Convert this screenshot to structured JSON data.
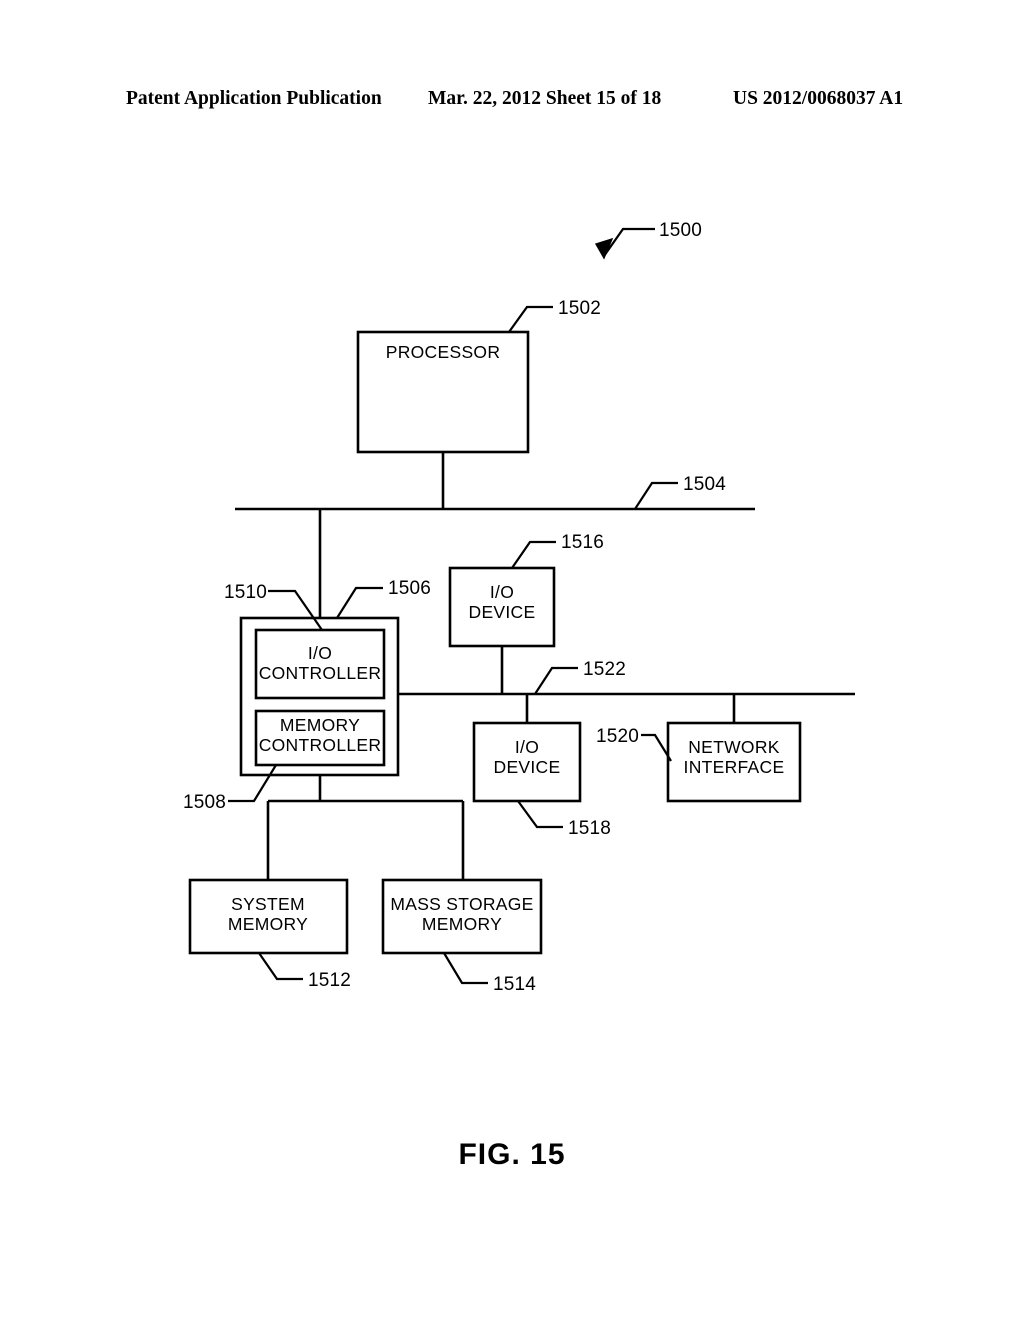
{
  "header": {
    "publication": "Patent Application Publication",
    "date_sheet": "Mar. 22, 2012  Sheet 15 of 18",
    "patent_number": "US 2012/0068037 A1"
  },
  "figure": {
    "caption": "FIG. 15",
    "system_ref": "1500"
  },
  "blocks": {
    "processor": {
      "line1": "PROCESSOR",
      "ref": "1502"
    },
    "chipset": {
      "ref": "1506"
    },
    "io_controller": {
      "line1": "I/O",
      "line2": "CONTROLLER",
      "ref": "1510"
    },
    "memory_controller": {
      "line1": "MEMORY",
      "line2": "CONTROLLER",
      "ref": "1508"
    },
    "io_device_top": {
      "line1": "I/O",
      "line2": "DEVICE",
      "ref": "1516"
    },
    "io_device_bottom": {
      "line1": "I/O",
      "line2": "DEVICE",
      "ref": "1518"
    },
    "network_interface": {
      "line1": "NETWORK",
      "line2": "INTERFACE",
      "ref": "1520"
    },
    "system_memory": {
      "line1": "SYSTEM",
      "line2": "MEMORY",
      "ref": "1512"
    },
    "mass_storage_memory": {
      "line1": "MASS STORAGE",
      "line2": "MEMORY",
      "ref": "1514"
    }
  },
  "buses": {
    "primary": {
      "ref": "1504"
    },
    "secondary": {
      "ref": "1522"
    }
  },
  "colors": {
    "ink": "#000000",
    "paper": "#ffffff"
  }
}
